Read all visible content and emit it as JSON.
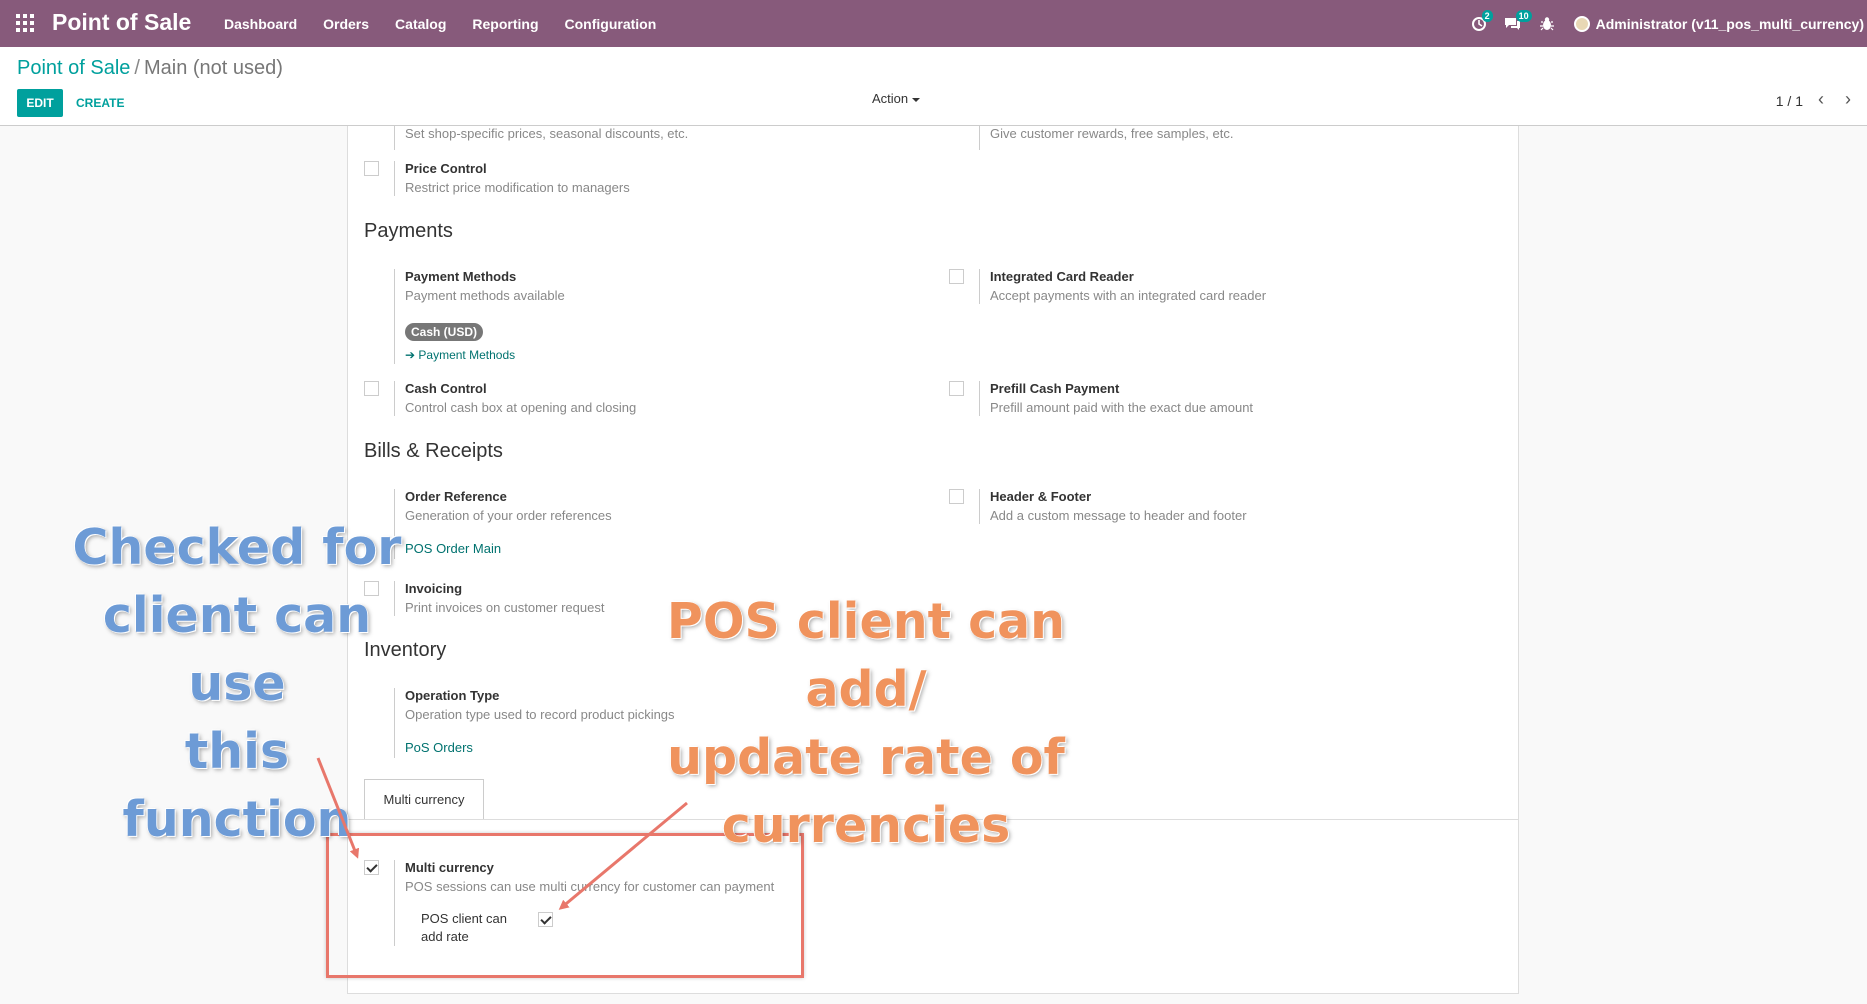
{
  "navbar": {
    "brand": "Point of Sale",
    "menu": [
      "Dashboard",
      "Orders",
      "Catalog",
      "Reporting",
      "Configuration"
    ],
    "activity_badge": "2",
    "messages_badge": "10",
    "user": "Administrator (v11_pos_multi_currency)",
    "background_color": "#875a7b"
  },
  "control_panel": {
    "breadcrumb_parent": "Point of Sale",
    "breadcrumb_separator": "/",
    "breadcrumb_current": "Main (not used)",
    "edit_label": "EDIT",
    "create_label": "CREATE",
    "action_label": "Action",
    "pager": "1 / 1",
    "accent_color": "#00a09d"
  },
  "form": {
    "pricing_partial_left": "Set shop-specific prices, seasonal discounts, etc.",
    "pricing_partial_right": "Give customer rewards, free samples, etc.",
    "price_control": {
      "title": "Price Control",
      "desc": "Restrict price modification to managers"
    },
    "payments_title": "Payments",
    "payment_methods": {
      "title": "Payment Methods",
      "desc": "Payment methods available",
      "tag": "Cash (USD)",
      "link": "Payment Methods"
    },
    "integrated_card_reader": {
      "title": "Integrated Card Reader",
      "desc": "Accept payments with an integrated card reader"
    },
    "cash_control": {
      "title": "Cash Control",
      "desc": "Control cash box at opening and closing"
    },
    "prefill_cash": {
      "title": "Prefill Cash Payment",
      "desc": "Prefill amount paid with the exact due amount"
    },
    "bills_title": "Bills & Receipts",
    "order_reference": {
      "title": "Order Reference",
      "desc": "Generation of your order references",
      "link": "POS Order Main"
    },
    "header_footer": {
      "title": "Header & Footer",
      "desc": "Add a custom message to header and footer"
    },
    "invoicing": {
      "title": "Invoicing",
      "desc": "Print invoices on customer request"
    },
    "inventory_title": "Inventory",
    "operation_type": {
      "title": "Operation Type",
      "desc": "Operation type used to record product pickings",
      "link": "PoS Orders"
    },
    "tab_label": "Multi currency",
    "multi_currency": {
      "title": "Multi currency",
      "desc": "POS sessions can use multi currency for customer can payment",
      "checked": true
    },
    "client_add_rate": {
      "label_line1": "POS client can",
      "label_line2": "add rate",
      "checked": true
    }
  },
  "annotations": {
    "blue_line1": "Checked for",
    "blue_line2": "client can use",
    "blue_line3": "this function",
    "orange_line1": "POS client can add/",
    "orange_line2": "update rate of",
    "orange_line3": "currencies",
    "box_color": "#e8776b",
    "blue_color": "#6d9bd6",
    "orange_color": "#f0935d"
  }
}
